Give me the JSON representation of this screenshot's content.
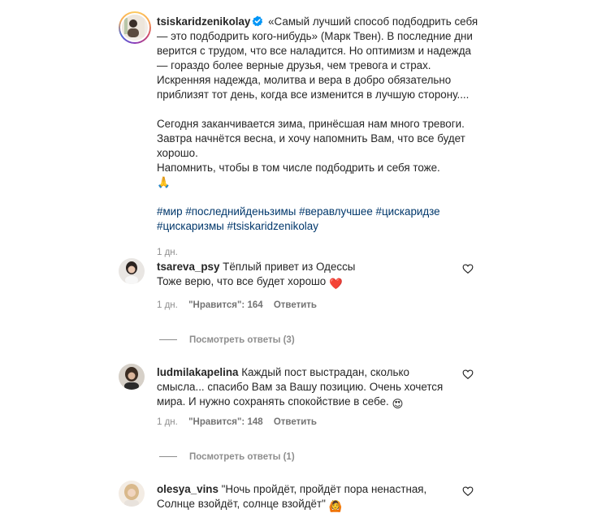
{
  "post": {
    "author": "tsiskaridzenikolay",
    "caption_paragraph_1": "«Самый лучший способ подбодрить себя — это подбодрить кого-нибудь» (Марк Твен). В последние дни верится с трудом, что все наладится. Но оптимизм и надежда — гораздо более верные друзья, чем тревога и страх. Искренняя надежда, молитва и вера в добро обязательно приблизят тот день, когда все изменится в лучшую сторону....",
    "caption_paragraph_2": "Сегодня заканчивается зима, принёсшая нам много тревоги. Завтра начнётся весна, и хочу напомнить Вам, что все будет хорошо.",
    "caption_paragraph_3": "Напомнить, чтобы в том числе подбодрить и себя тоже.",
    "caption_emoji": "🙏",
    "hashtags": [
      "#мир",
      "#последнийденьзимы",
      "#веравлучшее",
      "#цискаридзе",
      "#цискаризмы",
      "#tsiskaridzenikolay"
    ],
    "time": "1 дн."
  },
  "comments": [
    {
      "username": "tsareva_psy",
      "text_line1": "Тёплый привет из Одессы",
      "text_line2": "Тоже верю, что все будет хорошо",
      "emoji": "❤️",
      "time": "1 дн.",
      "likes": "\"Нравится\": 164",
      "reply": "Ответить",
      "view_replies": "Посмотреть ответы (3)"
    },
    {
      "username": "ludmilakapelina",
      "text": "Каждый пост выстрадан, сколько смысла... спасибо Вам за Вашу позицию. Очень хочется мира. И нужно сохранять спокойствие в себе.",
      "emoji": "😍",
      "time": "1 дн.",
      "likes": "\"Нравится\": 148",
      "reply": "Ответить",
      "view_replies": "Посмотреть ответы (1)"
    },
    {
      "username": "olesya_vins",
      "text": "\"Ночь пройдёт, пройдёт пора ненастная, Солнце взойдёт, солнце взойдёт\"",
      "emoji": "🙆"
    }
  ],
  "icons": {
    "verified": "verified-badge-icon",
    "like": "heart-outline-icon"
  },
  "colors": {
    "text": "#262626",
    "secondary": "#8e8e8e",
    "hashtag": "#00376b",
    "verified": "#0095f6",
    "heart_emoji": "#e0245e"
  }
}
